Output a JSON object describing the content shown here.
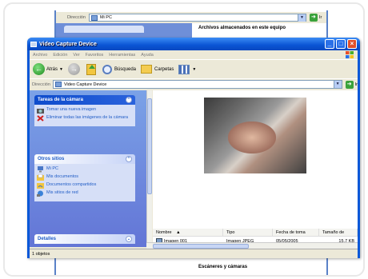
{
  "background_window": {
    "address_label": "Dirección",
    "address_value": "Mi PC",
    "go_label": "Ir",
    "heading_top": "Archivos almacenados en este equipo",
    "heading_bottom": "Escáneres y cámaras"
  },
  "window": {
    "title": "Video Capture Device",
    "menu": [
      "Archivo",
      "Edición",
      "Ver",
      "Favoritos",
      "Herramientas",
      "Ayuda"
    ],
    "toolbar": {
      "back_label": "Atrás",
      "search_label": "Búsqueda",
      "folders_label": "Carpetas"
    },
    "address": {
      "label": "Dirección",
      "value": "Video Capture Device",
      "go_label": "Ir"
    }
  },
  "taskpane": {
    "camera_tasks": {
      "title": "Tareas de la cámara",
      "items": [
        {
          "label": "Tomar una nueva imagen",
          "icon": "camera-icon"
        },
        {
          "label": "Eliminar todas las imágenes de la cámara",
          "icon": "delete-x-icon"
        }
      ]
    },
    "other_places": {
      "title": "Otros sitios",
      "items": [
        {
          "label": "Mi PC",
          "icon": "computer-icon"
        },
        {
          "label": "Mis documentos",
          "icon": "documents-icon"
        },
        {
          "label": "Documentos compartidos",
          "icon": "shared-folder-icon"
        },
        {
          "label": "Mis sitios de red",
          "icon": "network-icon"
        }
      ]
    },
    "details": {
      "title": "Detalles"
    }
  },
  "file_list": {
    "columns": [
      "Nombre",
      "Tipo",
      "Fecha de toma",
      "Tamaño de"
    ],
    "sort_indicator": "▲",
    "rows": [
      {
        "name": "Imagen 001",
        "type": "Imagen JPEG",
        "date": "05/05/2005",
        "size": "15,7 KB"
      }
    ]
  },
  "status": {
    "text": "1 objetos"
  },
  "colors": {
    "titlebar": "#0a54d4",
    "taskpane": "#6f88dc",
    "link": "#215dc6",
    "go_button": "#3aa23a"
  }
}
